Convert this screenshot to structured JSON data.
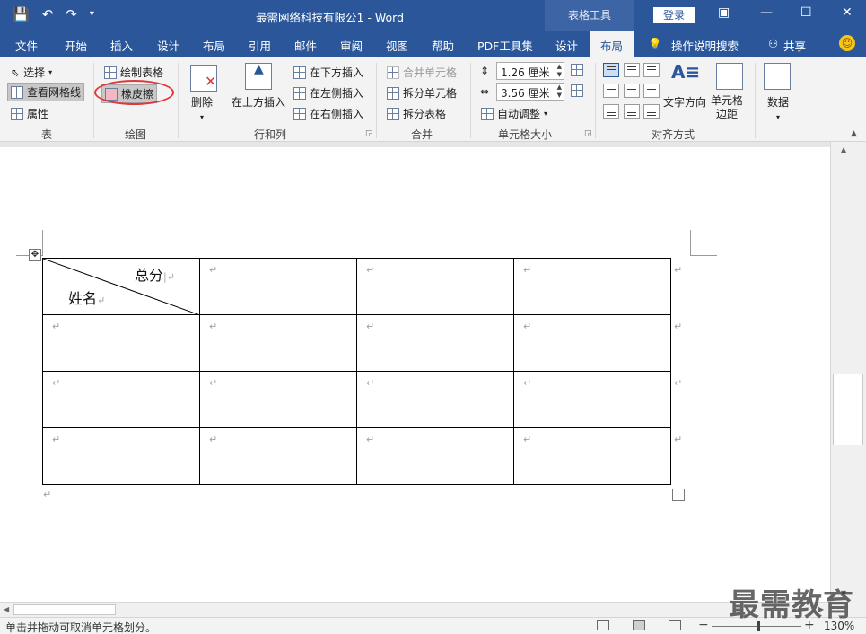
{
  "titlebar": {
    "title": "最需网络科技有限公1  -  Word",
    "context_tool": "表格工具",
    "login": "登录"
  },
  "tabs": {
    "file": "文件",
    "home": "开始",
    "insert": "插入",
    "design": "设计",
    "layout_doc": "布局",
    "references": "引用",
    "mailings": "邮件",
    "review": "审阅",
    "view": "视图",
    "help": "帮助",
    "pdf": "PDF工具集",
    "table_design": "设计",
    "table_layout": "布局",
    "tell_me": "操作说明搜索",
    "share": "共享"
  },
  "ribbon": {
    "table_group": {
      "label": "表",
      "select": "选择",
      "gridlines": "查看网格线",
      "properties": "属性"
    },
    "draw_group": {
      "label": "绘图",
      "draw_table": "绘制表格",
      "eraser": "橡皮擦"
    },
    "rows_cols_group": {
      "label": "行和列",
      "delete": "删除",
      "insert_above": "在上方插入",
      "insert_below": "在下方插入",
      "insert_left": "在左侧插入",
      "insert_right": "在右侧插入"
    },
    "merge_group": {
      "label": "合并",
      "merge_cells": "合并单元格",
      "split_cells": "拆分单元格",
      "split_table": "拆分表格"
    },
    "cell_size_group": {
      "label": "单元格大小",
      "height": "1.26 厘米",
      "width": "3.56 厘米",
      "autofit": "自动调整"
    },
    "alignment_group": {
      "label": "对齐方式",
      "text_direction": "文字方向",
      "cell_margins_1": "单元格",
      "cell_margins_2": "边距"
    },
    "data_group": {
      "label": "数据"
    }
  },
  "document": {
    "header_cell_top": "总分",
    "header_cell_bottom": "姓名",
    "para_mark": "↵"
  },
  "status": {
    "hint": "单击并拖动可取消单元格划分。",
    "zoom": "130%"
  },
  "watermark": "最需教育"
}
